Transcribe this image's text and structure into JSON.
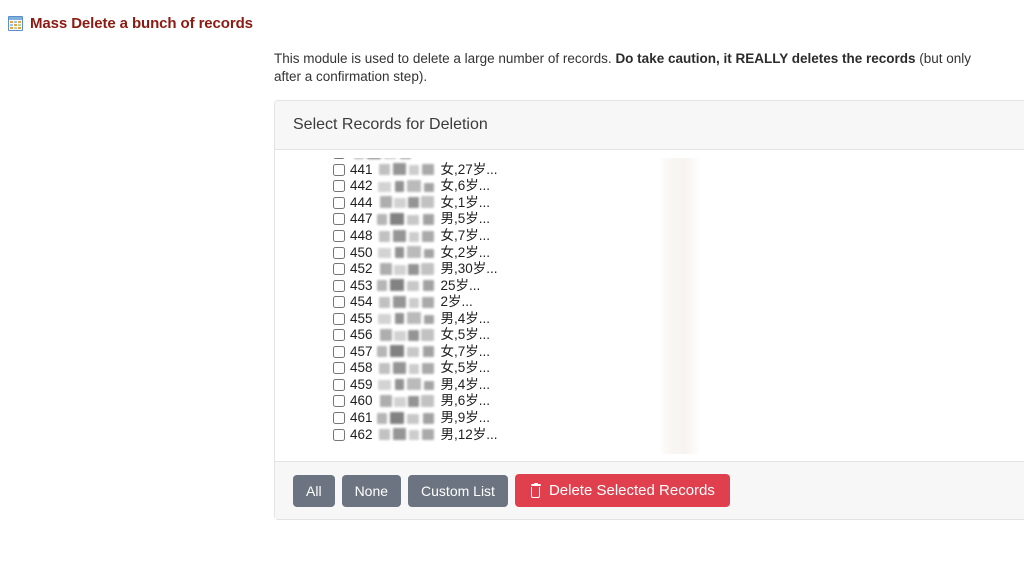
{
  "page": {
    "title": "Mass Delete a bunch of records",
    "title_icon": "grid-table-icon",
    "title_color": "#8b1a12"
  },
  "intro": {
    "lead": "This module is used to delete a large number of records. ",
    "emphasis": "Do take caution, it REALLY deletes the records",
    "tail": " (but only after a confirmation step)."
  },
  "panel": {
    "heading": "Select Records for Deletion",
    "records": [
      {
        "id": "441",
        "meta": "女,27岁..."
      },
      {
        "id": "442",
        "meta": "女,6岁..."
      },
      {
        "id": "444",
        "meta": "女,1岁..."
      },
      {
        "id": "447",
        "meta": "男,5岁..."
      },
      {
        "id": "448",
        "meta": "女,7岁..."
      },
      {
        "id": "450",
        "meta": "女,2岁..."
      },
      {
        "id": "452",
        "meta": "男,30岁..."
      },
      {
        "id": "453",
        "meta": "25岁..."
      },
      {
        "id": "454",
        "meta": "2岁..."
      },
      {
        "id": "455",
        "meta": "男,4岁..."
      },
      {
        "id": "456",
        "meta": "女,5岁..."
      },
      {
        "id": "457",
        "meta": "女,7岁..."
      },
      {
        "id": "458",
        "meta": "女,5岁..."
      },
      {
        "id": "459",
        "meta": "男,4岁..."
      },
      {
        "id": "460",
        "meta": "男,6岁..."
      },
      {
        "id": "461",
        "meta": "男,9岁..."
      },
      {
        "id": "462",
        "meta": "男,12岁..."
      }
    ],
    "footer": {
      "select_all_label": "All",
      "select_none_label": "None",
      "custom_list_label": "Custom List",
      "delete_label": "Delete Selected Records",
      "delete_icon": "trash-icon",
      "default_button_color": "#6b7480",
      "danger_button_color": "#e0404e"
    }
  }
}
